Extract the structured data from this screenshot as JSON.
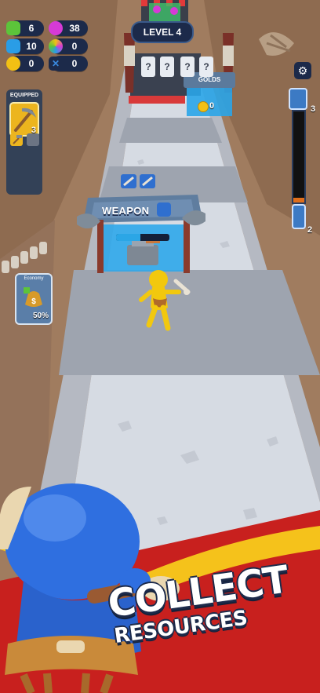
{
  "hud": {
    "resources": [
      {
        "name": "cash-icon",
        "value": "6",
        "color": "#5cc43a"
      },
      {
        "name": "gem-icon",
        "value": "38",
        "color": "#d63ad6"
      },
      {
        "name": "crystal-icon",
        "value": "10",
        "color": "#2a9de6"
      },
      {
        "name": "orb-icon",
        "value": "0",
        "color": "#9b59d6"
      },
      {
        "name": "coin-icon",
        "value": "0",
        "color": "#f2c014"
      },
      {
        "name": "bone-icon",
        "value": "0",
        "color": "#3a8ae0"
      }
    ],
    "level_label": "LEVEL 4",
    "equipped_label": "EQUIPPED",
    "equipped_count": "3",
    "economy_label": "Economy",
    "economy_percent": "50%",
    "progress": {
      "top_count": "3",
      "bottom_count": "2",
      "fill_fraction": 0.05
    }
  },
  "gates": {
    "weapon_label": "WEAPON",
    "weapon_progress_fraction": 0.45,
    "golds_label": "GOLDS",
    "golds_count": "0",
    "mystery_cards": [
      "?",
      "?",
      "?",
      "?"
    ]
  },
  "banner": {
    "line1": "COLLECT",
    "line2": "RESOURCES"
  },
  "colors": {
    "hud_dark": "#1c2a4a",
    "gold": "#f2b91c",
    "banner_red": "#c8201e",
    "banner_yellow": "#f5c21b",
    "character_blue": "#2f6fe0",
    "runner_yellow": "#f2c80e"
  }
}
